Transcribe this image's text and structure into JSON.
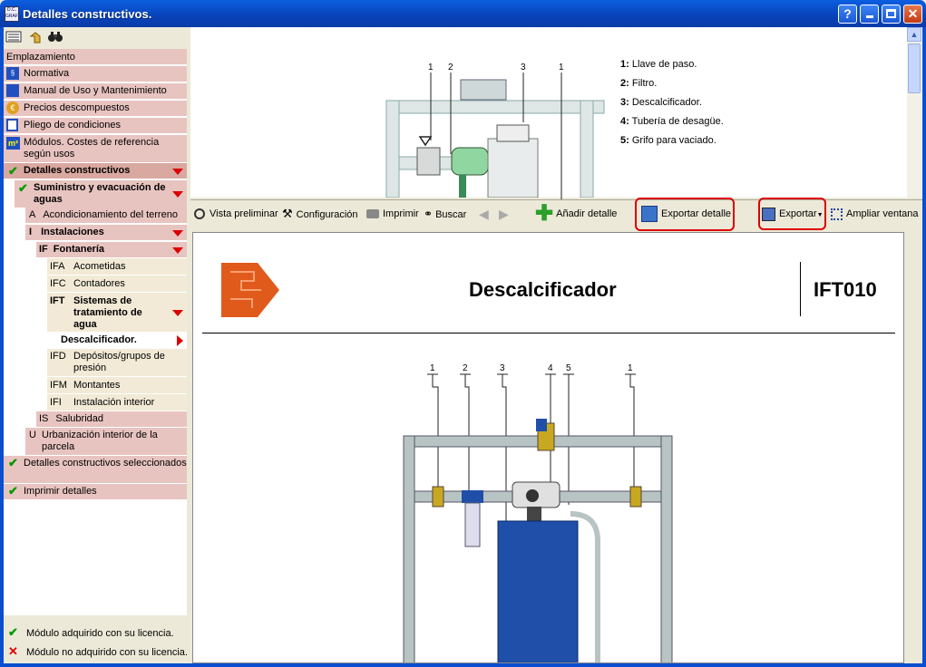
{
  "window": {
    "title": "Detalles constructivos.",
    "icon_text": "D.C. GRAF",
    "buttons": {
      "help": "?",
      "minimize": "_",
      "maximize": "□",
      "close": "✕"
    }
  },
  "left_toolbar": {
    "icons": [
      "list-icon",
      "up-level-icon",
      "binoculars-icon"
    ]
  },
  "tree": {
    "emplazamiento": "Emplazamiento",
    "normativa": "Normativa",
    "manual": "Manual de Uso y Mantenimiento",
    "precios": "Precios descompuestos",
    "pliego": "Pliego de condiciones",
    "modulos": "Módulos. Costes de referencia según usos",
    "detalles": "Detalles constructivos",
    "suministro": "Suministro y evacuación de aguas",
    "a_code": "A",
    "a_label": "Acondicionamiento del terreno",
    "i_code": "I",
    "i_label": "Instalaciones",
    "if_code": "IF",
    "if_label": "Fontanería",
    "ifa_code": "IFA",
    "ifa_label": "Acometidas",
    "ifc_code": "IFC",
    "ifc_label": "Contadores",
    "ift_code": "IFT",
    "ift_label": "Sistemas de tratamiento de agua",
    "descal": "Descalcificador.",
    "ifd_code": "IFD",
    "ifd_label": "Depósitos/grupos de presión",
    "ifm_code": "IFM",
    "ifm_label": "Montantes",
    "ifi_code": "IFI",
    "ifi_label": "Instalación interior",
    "is_code": "IS",
    "is_label": "Salubridad",
    "u_code": "U",
    "u_label": "Urbanización interior de la parcela",
    "seleccionados": "Detalles constructivos seleccionados",
    "imprimir": "Imprimir detalles"
  },
  "license_legend": {
    "acquired": "Módulo adquirido con su licencia.",
    "not_acquired": "Módulo no adquirido con su licencia.",
    "check": "✔",
    "cross": "✕"
  },
  "legend": {
    "items": [
      {
        "num": "1:",
        "text": "Llave de paso."
      },
      {
        "num": "2:",
        "text": "Filtro."
      },
      {
        "num": "3:",
        "text": "Descalcificador."
      },
      {
        "num": "4:",
        "text": "Tubería de desagüe."
      },
      {
        "num": "5:",
        "text": "Grifo para vaciado."
      }
    ],
    "thumb_labels": [
      "1",
      "2",
      "3",
      "1"
    ]
  },
  "toolbar": {
    "vista": "Vista preliminar",
    "config": "Configuración",
    "imprimir": "Imprimir",
    "buscar": "Buscar",
    "anadir": "Añadir detalle",
    "exportar_detalle": "Exportar detalle",
    "exportar": "Exportar",
    "ampliar": "Ampliar ventana"
  },
  "document": {
    "title": "Descalcificador",
    "code": "IFT010",
    "callouts": [
      "1",
      "2",
      "3",
      "4",
      "5",
      "1"
    ]
  },
  "colors": {
    "tree_pink": "#e8c4c0",
    "tree_beige": "#f2ead6",
    "tree_bold": "#d9a8a0",
    "accent_red": "#dd0000",
    "tank_blue": "#1f4fa8",
    "pipe_gray": "#b8c4c4",
    "logo_orange": "#e05a1c"
  }
}
